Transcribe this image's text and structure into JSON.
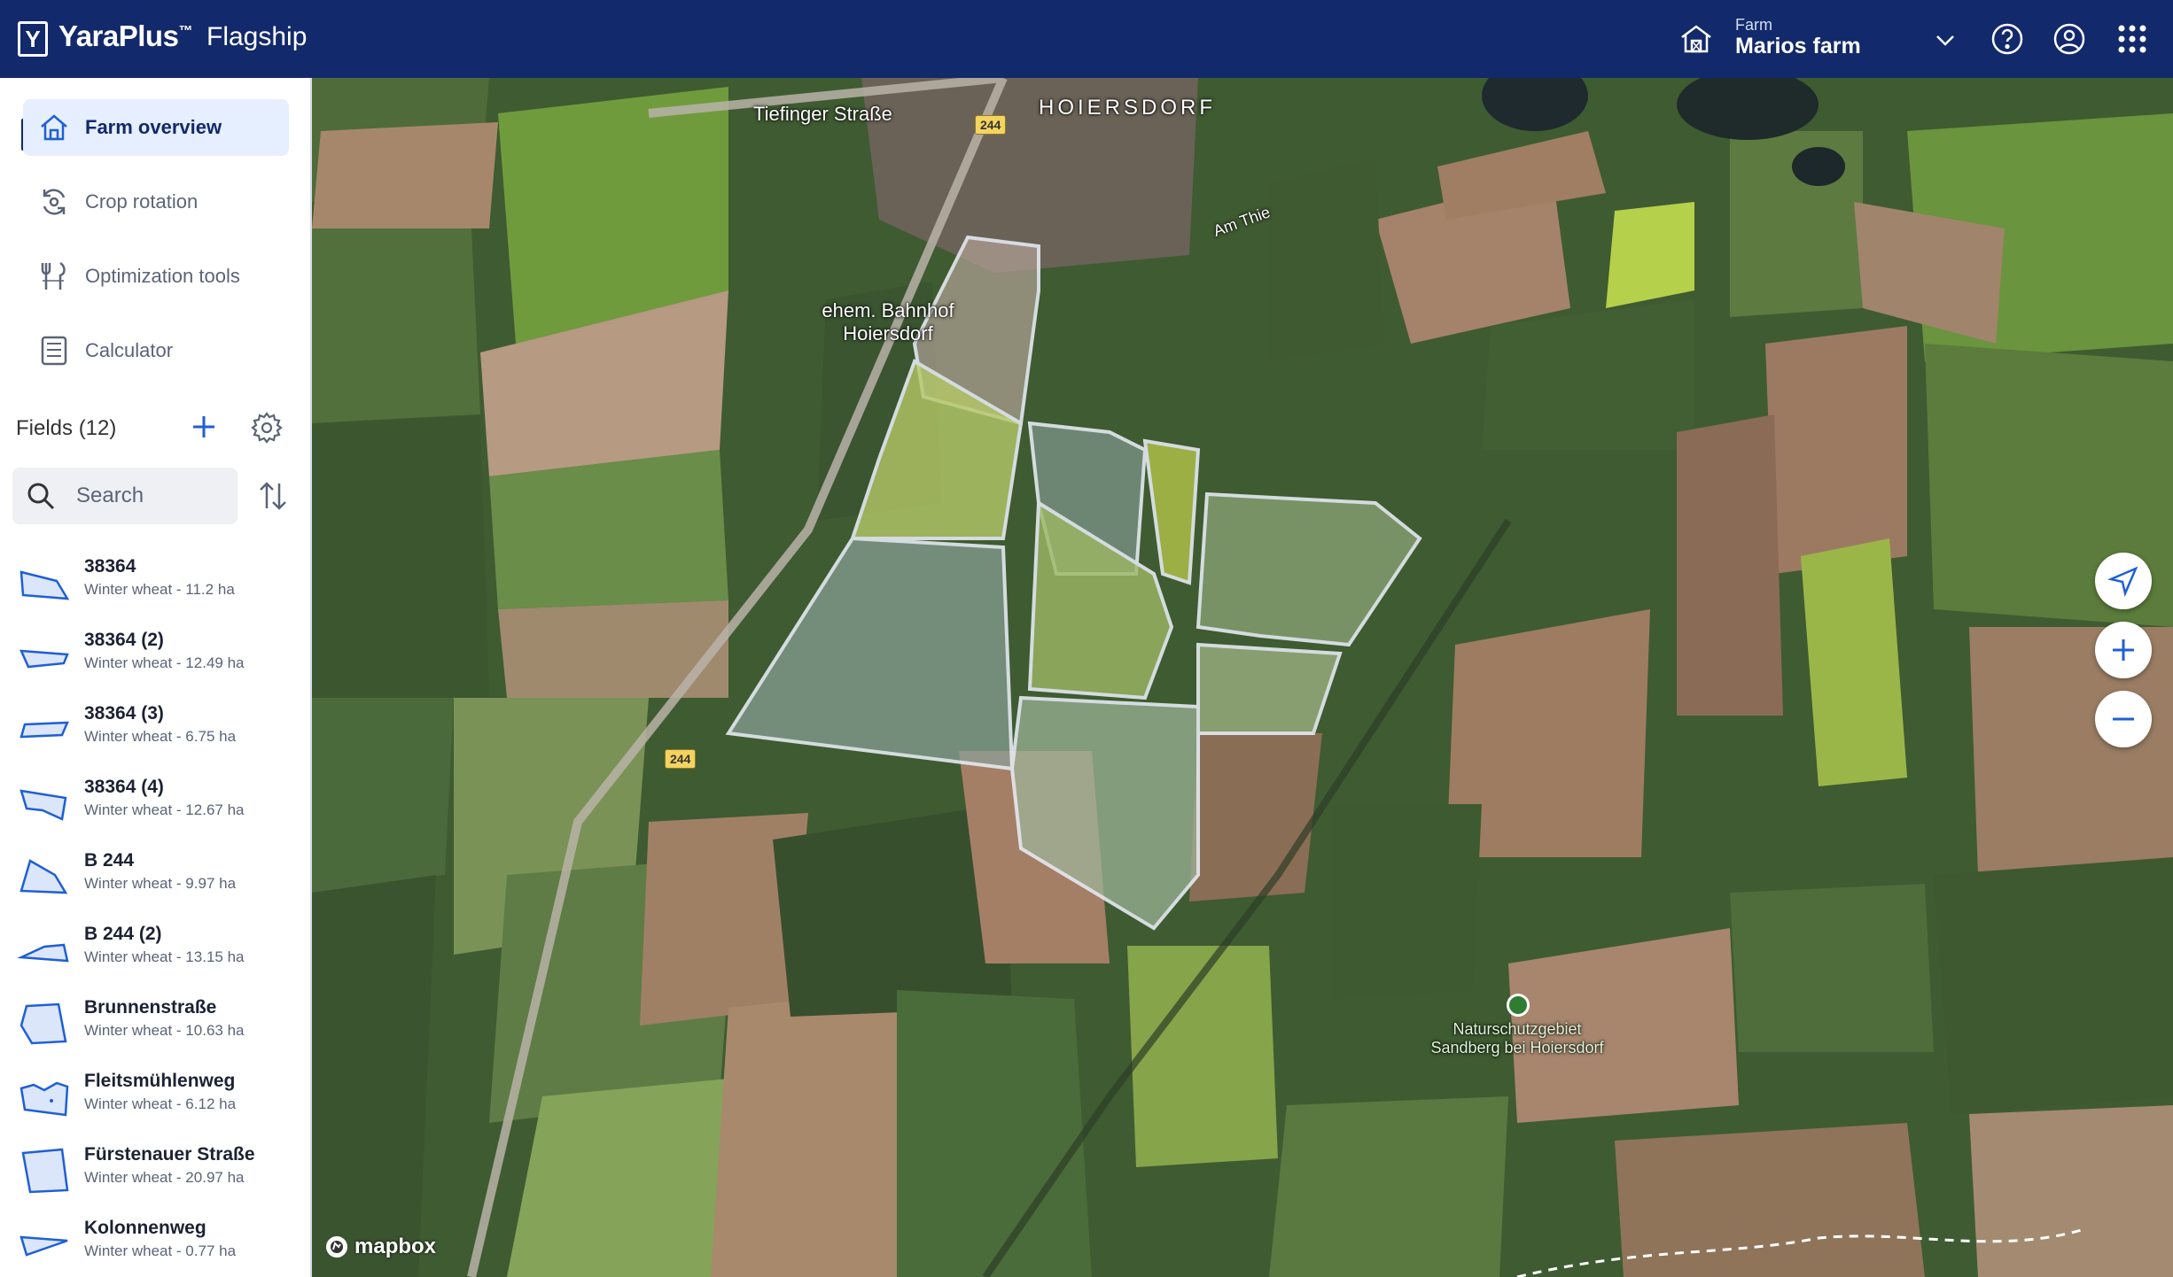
{
  "header": {
    "logo_letter": "Y",
    "brand": "YaraPlus",
    "brand_mark": "™",
    "product": "Flagship",
    "farm_caption": "Farm",
    "farm_name": "Marios farm",
    "icons": [
      "farm-icon",
      "chevron-down-icon",
      "help-icon",
      "account-icon",
      "apps-grid-icon"
    ]
  },
  "nav": {
    "items": [
      {
        "label": "Farm overview",
        "icon": "home-icon",
        "active": true
      },
      {
        "label": "Crop rotation",
        "icon": "rotation-icon",
        "active": false
      },
      {
        "label": "Optimization tools",
        "icon": "tools-icon",
        "active": false
      },
      {
        "label": "Calculator",
        "icon": "calculator-icon",
        "active": false
      }
    ]
  },
  "fields": {
    "title": "Fields (12)",
    "search_placeholder": "Search",
    "items": [
      {
        "name": "38364",
        "meta": "Winter wheat - 11.2 ha"
      },
      {
        "name": "38364 (2)",
        "meta": "Winter wheat - 12.49 ha"
      },
      {
        "name": "38364 (3)",
        "meta": "Winter wheat - 6.75 ha"
      },
      {
        "name": "38364 (4)",
        "meta": "Winter wheat - 12.67 ha"
      },
      {
        "name": "B 244",
        "meta": "Winter wheat - 9.97 ha"
      },
      {
        "name": "B 244 (2)",
        "meta": "Winter wheat - 13.15 ha"
      },
      {
        "name": "Brunnenstraße",
        "meta": "Winter wheat - 10.63 ha"
      },
      {
        "name": "Fleitsmühlenweg",
        "meta": "Winter wheat - 6.12 ha"
      },
      {
        "name": "Fürstenauer Straße",
        "meta": "Winter wheat - 20.97 ha"
      },
      {
        "name": "Kolonnenweg",
        "meta": "Winter wheat - 0.77 ha"
      }
    ]
  },
  "map": {
    "labels": {
      "street": "Tiefinger Straße",
      "village": "HOIERSDORF",
      "am_thie": "Am Thie",
      "bahnhof_1": "ehem. Bahnhof",
      "bahnhof_2": "Hoiersdorf",
      "road_number": "244",
      "road_number_2": "244",
      "nature_1": "Naturschutzgebiet",
      "nature_2": "Sandberg bei Hoiersdorf"
    },
    "attribution": "mapbox"
  },
  "colors": {
    "header_bg": "#12296b",
    "active_nav_bg": "#e6efff",
    "accent_blue": "#1f5fd6",
    "field_shape_fill": "#dbe6fb"
  }
}
